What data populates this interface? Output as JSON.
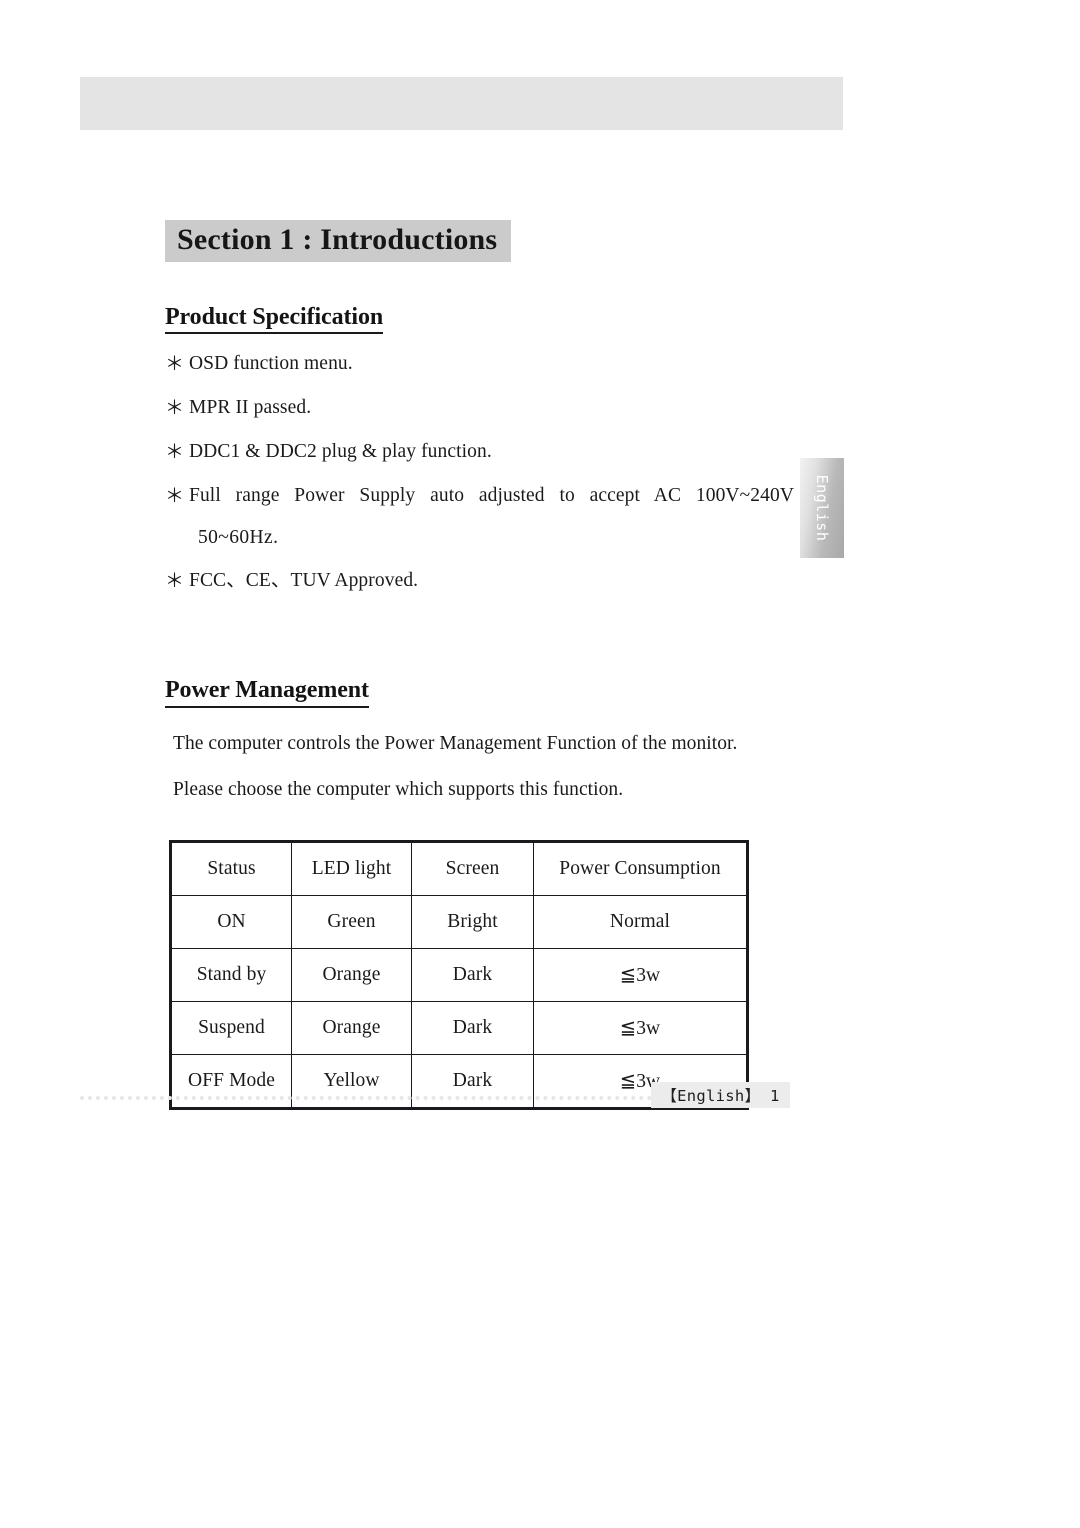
{
  "document": {
    "header_bar_label": "",
    "section_title": "Section 1 : Introductions"
  },
  "product_specification": {
    "heading": "Product Specification ",
    "bullet_marker": "＊",
    "items": [
      {
        "text": "OSD function menu."
      },
      {
        "text": "MPR II passed."
      },
      {
        "text": "DDC1 & DDC2 plug & play function."
      },
      {
        "text": "Full range Power Supply auto adjusted to accept AC 100V~240V",
        "continuation": "50~60Hz."
      },
      {
        "text": "FCC、CE、TUV Approved."
      }
    ]
  },
  "power_management": {
    "heading": "Power Management ",
    "paragraphs": [
      "The computer controls the Power Management Function of the monitor.",
      "Please choose the computer which supports this function."
    ],
    "table": {
      "headers": [
        "Status",
        "LED light",
        "Screen",
        "Power Consumption"
      ],
      "rows": [
        [
          "ON",
          "Green",
          "Bright",
          "Normal"
        ],
        [
          "Stand by",
          "Orange",
          "Dark",
          "≦3w"
        ],
        [
          "Suspend",
          "Orange",
          "Dark",
          "≦3w"
        ],
        [
          "OFF Mode",
          "Yellow",
          "Dark",
          "≦3w"
        ]
      ]
    }
  },
  "side_tab": {
    "label": "English"
  },
  "footer": {
    "page_label": "【English】 1"
  }
}
